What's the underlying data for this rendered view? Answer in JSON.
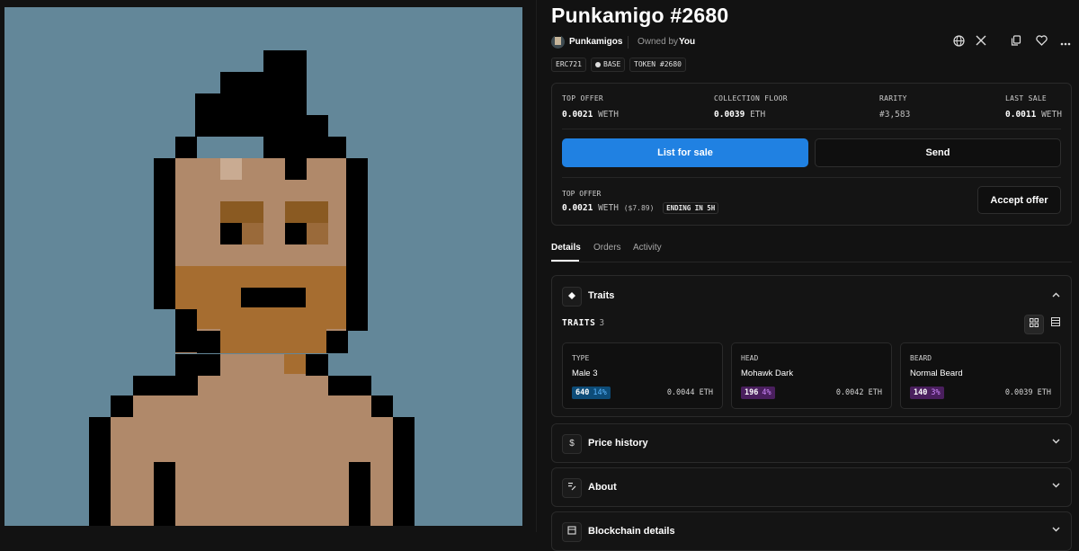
{
  "nft": {
    "title": "Punkamigo #2680"
  },
  "owner_row": {
    "collection_name": "Punkamigos",
    "owned_by_label": "Owned by",
    "owner_name": "You"
  },
  "header_icons": [
    "globe-icon",
    "x-icon",
    "copy-icon",
    "heart-icon",
    "more-icon"
  ],
  "chips": {
    "standard": "ERC721",
    "chain": "BASE",
    "token": "TOKEN #2680"
  },
  "stats": [
    {
      "label": "TOP OFFER",
      "value": "0.0021",
      "unit": "WETH"
    },
    {
      "label": "COLLECTION FLOOR",
      "value": "0.0039",
      "unit": "ETH"
    },
    {
      "label": "RARITY",
      "value": "#3,583",
      "unit": ""
    },
    {
      "label": "LAST SALE",
      "value": "0.0011",
      "unit": "WETH"
    }
  ],
  "actions": {
    "list_label": "List for sale",
    "send_label": "Send",
    "accept_label": "Accept offer"
  },
  "top_offer": {
    "label": "TOP OFFER",
    "value": "0.0021",
    "unit": "WETH",
    "usd": "($7.89)",
    "ending": "ENDING IN 5H"
  },
  "tabs": [
    "Details",
    "Orders",
    "Activity"
  ],
  "active_tab": "Details",
  "traits_panel": {
    "title": "Traits",
    "label": "TRAITS",
    "count": "3",
    "items": [
      {
        "type": "TYPE",
        "value": "Male 3",
        "count": "640",
        "percent": "14%",
        "price": "0.0044 ETH",
        "badge_color": "#0d4c78",
        "text_color": "#5cb6ff"
      },
      {
        "type": "HEAD",
        "value": "Mohawk Dark",
        "count": "196",
        "percent": "4%",
        "price": "0.0042 ETH",
        "badge_color": "#4a1f5e",
        "text_color": "#d089ff"
      },
      {
        "type": "BEARD",
        "value": "Normal Beard",
        "count": "140",
        "percent": "3%",
        "price": "0.0039 ETH",
        "badge_color": "#4a1f5e",
        "text_color": "#d089ff"
      }
    ]
  },
  "sections": {
    "price_history": "Price history",
    "about": "About",
    "blockchain": "Blockchain details"
  },
  "colors": {
    "accent": "#2081e2",
    "background": "#121212",
    "art_background": "#638799"
  }
}
